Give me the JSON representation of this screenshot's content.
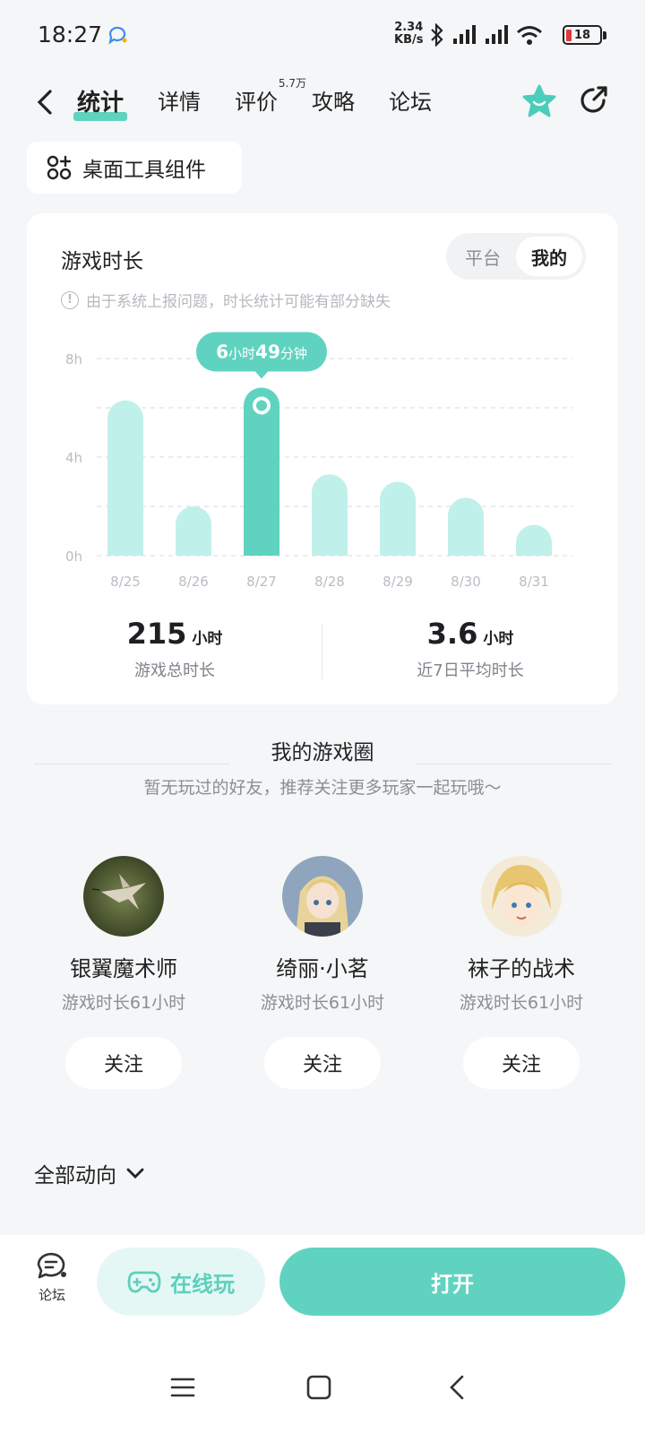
{
  "status_bar": {
    "time": "18:27",
    "net_speed_value": "2.34",
    "net_speed_unit": "KB/s",
    "battery": "18",
    "icons": [
      "message-icon",
      "bluetooth-icon",
      "signal-icon",
      "wifi-icon",
      "battery-icon"
    ]
  },
  "header": {
    "tabs": [
      {
        "label": "统计",
        "active": true
      },
      {
        "label": "详情"
      },
      {
        "label": "评价",
        "badge": "5.7万"
      },
      {
        "label": "攻略"
      },
      {
        "label": "论坛"
      }
    ]
  },
  "widget_button": {
    "label": "桌面工具组件"
  },
  "playtime_card": {
    "title": "游戏时长",
    "toggle": [
      "平台",
      "我的"
    ],
    "toggle_selected": "我的",
    "notice": "由于系统上报问题，时长统计可能有部分缺失",
    "stats": {
      "total_value": "215",
      "total_unit": "小时",
      "total_label": "游戏总时长",
      "avg_value": "3.6",
      "avg_unit": "小时",
      "avg_label": "近7日平均时长"
    }
  },
  "chart_data": {
    "type": "bar",
    "categories": [
      "8/25",
      "8/26",
      "8/27",
      "8/28",
      "8/29",
      "8/30",
      "8/31"
    ],
    "values": [
      6.3,
      2.0,
      6.82,
      3.3,
      3.0,
      2.35,
      1.25
    ],
    "y_ticks": [
      "0h",
      "4h",
      "8h"
    ],
    "ylim": [
      0,
      8
    ],
    "highlight_index": 2,
    "tooltip": {
      "hours": "6",
      "hours_unit": "小时",
      "minutes": "49",
      "minutes_unit": "分钟"
    },
    "colors": {
      "bar": "#c0f0ea",
      "highlight": "#5fd3c0"
    },
    "grid": true
  },
  "game_circle": {
    "title": "我的游戏圈",
    "subtitle": "暂无玩过的好友，推荐关注更多玩家一起玩哦～",
    "users": [
      {
        "name": "银翼魔术师",
        "playtime": "游戏时长61小时",
        "follow": "关注"
      },
      {
        "name": "绮丽·小茗",
        "playtime": "游戏时长61小时",
        "follow": "关注"
      },
      {
        "name": "袜子的战术",
        "playtime": "游戏时长61小时",
        "follow": "关注"
      }
    ]
  },
  "feed": {
    "label": "全部动向"
  },
  "bottom_bar": {
    "forum_label": "论坛",
    "online_label": "在线玩",
    "open_label": "打开"
  },
  "colors": {
    "accent": "#5fd3c0",
    "accent_light": "#e5f7f4",
    "background": "#f4f6f8"
  }
}
